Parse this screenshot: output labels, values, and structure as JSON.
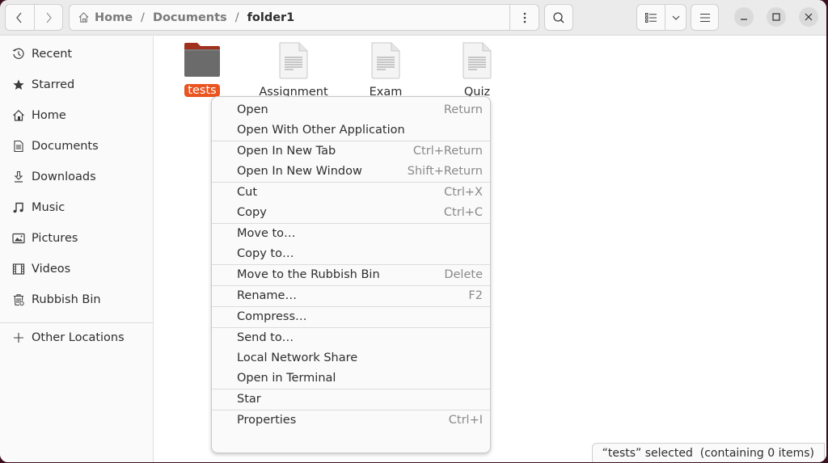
{
  "header": {
    "back_icon": "chevron-left-icon",
    "forward_icon": "chevron-right-icon",
    "breadcrumb": {
      "home_icon": "home-icon",
      "items": [
        "Home",
        "Documents",
        "folder1"
      ],
      "separator": "/"
    },
    "path_menu_icon": "vertical-dots-icon",
    "search_icon": "search-icon",
    "view_list_icon": "list-view-icon",
    "view_options_icon": "chevron-down-icon",
    "main_menu_icon": "hamburger-icon",
    "minimize_icon": "minimize-icon",
    "maximize_icon": "maximize-icon",
    "close_icon": "close-icon"
  },
  "sidebar": {
    "items": [
      {
        "label": "Recent",
        "icon": "clock-icon"
      },
      {
        "label": "Starred",
        "icon": "star-icon"
      },
      {
        "label": "Home",
        "icon": "home-icon"
      },
      {
        "label": "Documents",
        "icon": "document-icon"
      },
      {
        "label": "Downloads",
        "icon": "download-icon"
      },
      {
        "label": "Music",
        "icon": "music-icon"
      },
      {
        "label": "Pictures",
        "icon": "picture-icon"
      },
      {
        "label": "Videos",
        "icon": "film-icon"
      },
      {
        "label": "Rubbish Bin",
        "icon": "trash-icon"
      }
    ],
    "other_locations": {
      "label": "Other Locations",
      "icon": "plus-icon"
    }
  },
  "files": [
    {
      "name": "tests",
      "type": "folder",
      "selected": true
    },
    {
      "name": "Assignment",
      "type": "text-file",
      "selected": false
    },
    {
      "name": "Exam",
      "type": "text-file",
      "selected": false
    },
    {
      "name": "Quiz",
      "type": "text-file",
      "selected": false
    }
  ],
  "context_menu": {
    "items": [
      {
        "label": "Open",
        "accel": "Return"
      },
      {
        "label": "Open With Other Application",
        "accel": ""
      },
      {
        "label": "Open In New Tab",
        "accel": "Ctrl+Return"
      },
      {
        "label": "Open In New Window",
        "accel": "Shift+Return"
      },
      {
        "label": "Cut",
        "accel": "Ctrl+X"
      },
      {
        "label": "Copy",
        "accel": "Ctrl+C"
      },
      {
        "label": "Move to…",
        "accel": ""
      },
      {
        "label": "Copy to…",
        "accel": ""
      },
      {
        "label": "Move to the Rubbish Bin",
        "accel": "Delete"
      },
      {
        "label": "Rename…",
        "accel": "F2"
      },
      {
        "label": "Compress…",
        "accel": ""
      },
      {
        "label": "Send to…",
        "accel": ""
      },
      {
        "label": "Local Network Share",
        "accel": ""
      },
      {
        "label": "Open in Terminal",
        "accel": ""
      },
      {
        "label": "Star",
        "accel": ""
      },
      {
        "label": "Properties",
        "accel": "Ctrl+I"
      }
    ]
  },
  "status": {
    "text": "“tests” selected  (containing 0 items)"
  },
  "colors": {
    "accent": "#e95420",
    "folder_gray": "#6b6b6b",
    "folder_tab": "#a0311e"
  }
}
